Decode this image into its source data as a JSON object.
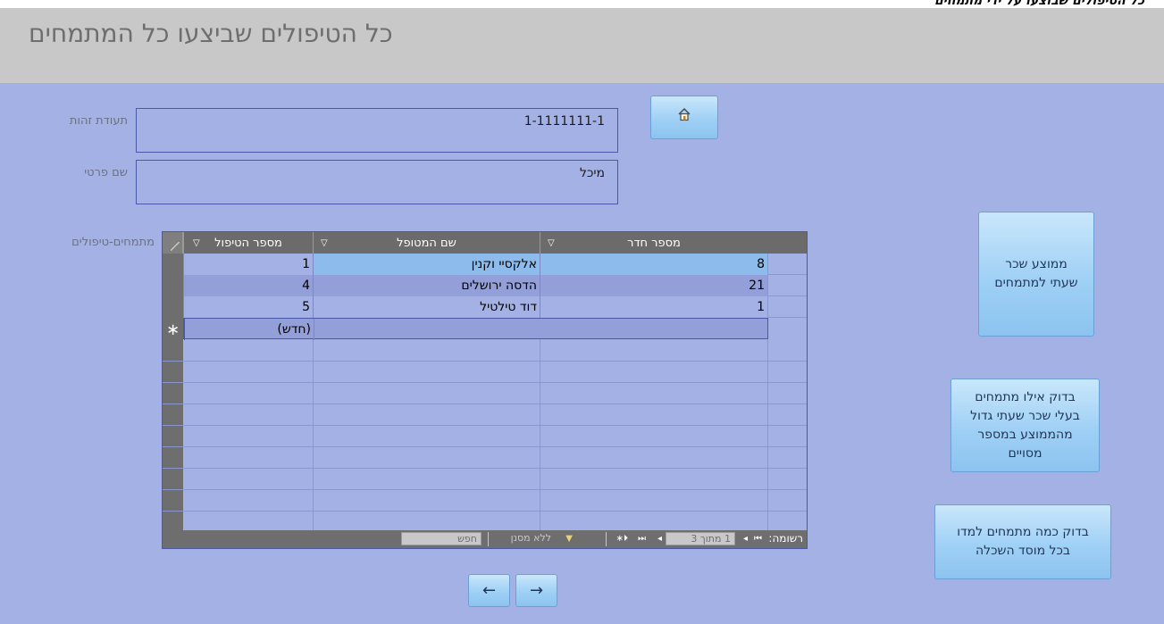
{
  "window": {
    "top_strip_text": "כל הטיפולים שבוצעו על ידי מתמחים",
    "title": "כל הטיפולים שביצעו כל המתמחים"
  },
  "fields": {
    "id_label": "תעודת זהות",
    "id_value": "1-1111111-1",
    "first_name_label": "שם פרטי",
    "first_name_value": "מיכל",
    "subform_label": "מתמחים-טיפולים"
  },
  "buttons": {
    "home_icon": "home-icon",
    "avg_wage": [
      "ממוצע שכר",
      "שעתי למתמחים"
    ],
    "check_above_avg": [
      "בדוק אילו מתמחים",
      "בעלי שכר שעתי גדול",
      "מהממוצע במספר",
      "מסויים"
    ],
    "check_per_institution": [
      "בדוק כמה מתמחים למדו",
      "בכל מוסד השכלה"
    ],
    "prev_icon": "arrow-left-icon",
    "next_icon": "arrow-right-icon",
    "prev_glyph": "←",
    "next_glyph": "→"
  },
  "table": {
    "columns": [
      "מספר הטיפול",
      "שם המטופל",
      "מספר חדר"
    ],
    "rows": [
      {
        "treatment_no": "1",
        "patient": "אלקסיי וקנין",
        "room": "8"
      },
      {
        "treatment_no": "4",
        "patient": "הדסה ירושלים",
        "room": "21"
      },
      {
        "treatment_no": "5",
        "patient": "דוד טילטיל",
        "room": "1"
      }
    ],
    "new_row_label": "(חדש)",
    "sort_glyph": "▽"
  },
  "navigation": {
    "record_label": "רשומה:",
    "record_position": "1 מתוך 3",
    "no_filter": "ללא מסנן",
    "search": "חפש"
  },
  "colors": {
    "background": "#a3b1e4",
    "header_band": "#c8c8c8",
    "button_face": "#9fd0f5",
    "grid_header": "#6b6b6b"
  }
}
